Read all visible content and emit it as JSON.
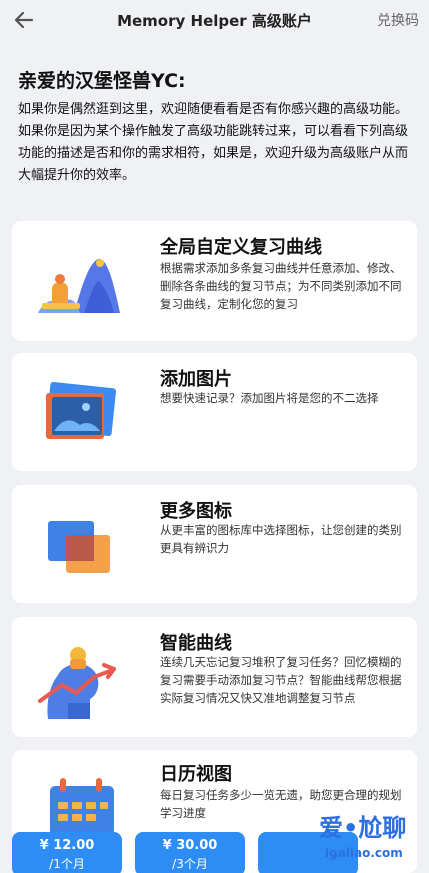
{
  "header": {
    "title": "Memory Helper 高级账户",
    "redeem_label": "兑换码"
  },
  "intro": {
    "greeting": "亲爱的汉堡怪兽YC:",
    "para1": "如果你是偶然逛到这里，欢迎随便看看是否有你感兴趣的高级功能。",
    "para2": "如果你是因为某个操作触发了高级功能跳转过来，可以看看下列高级功能的描述是否和你的需求相符，如果是，欢迎升级为高级账户从而大幅提升你的效率。"
  },
  "features": [
    {
      "icon": "mountain-curve-icon",
      "title": "全局自定义复习曲线",
      "desc": "根据需求添加多条复习曲线并任意添加、修改、删除各条曲线的复习节点；为不同类别添加不同复习曲线，定制化您的复习"
    },
    {
      "icon": "image-icon",
      "title": "添加图片",
      "desc": "想要快速记录？添加图片将是您的不二选择"
    },
    {
      "icon": "icons-library-icon",
      "title": "更多图标",
      "desc": "从更丰富的图标库中选择图标，让您创建的类别更具有辨识力"
    },
    {
      "icon": "smart-curve-icon",
      "title": "智能曲线",
      "desc": "连续几天忘记复习堆积了复习任务？回忆模糊的复习需要手动添加复习节点？智能曲线帮您根据实际复习情况又快又准地调整复习节点"
    },
    {
      "icon": "calendar-icon",
      "title": "日历视图",
      "desc": "每日复习任务多少一览无遗，助您更合理的规划学习进度"
    }
  ],
  "plans": [
    {
      "price": "¥ 12.00",
      "period": "/1个月"
    },
    {
      "price": "¥ 30.00",
      "period": "/3个月"
    }
  ],
  "watermark": {
    "line1": "爱•尬聊",
    "line2": "igaliao.com"
  },
  "colors": {
    "accent": "#2d8df5",
    "background": "#f0f1f5"
  }
}
